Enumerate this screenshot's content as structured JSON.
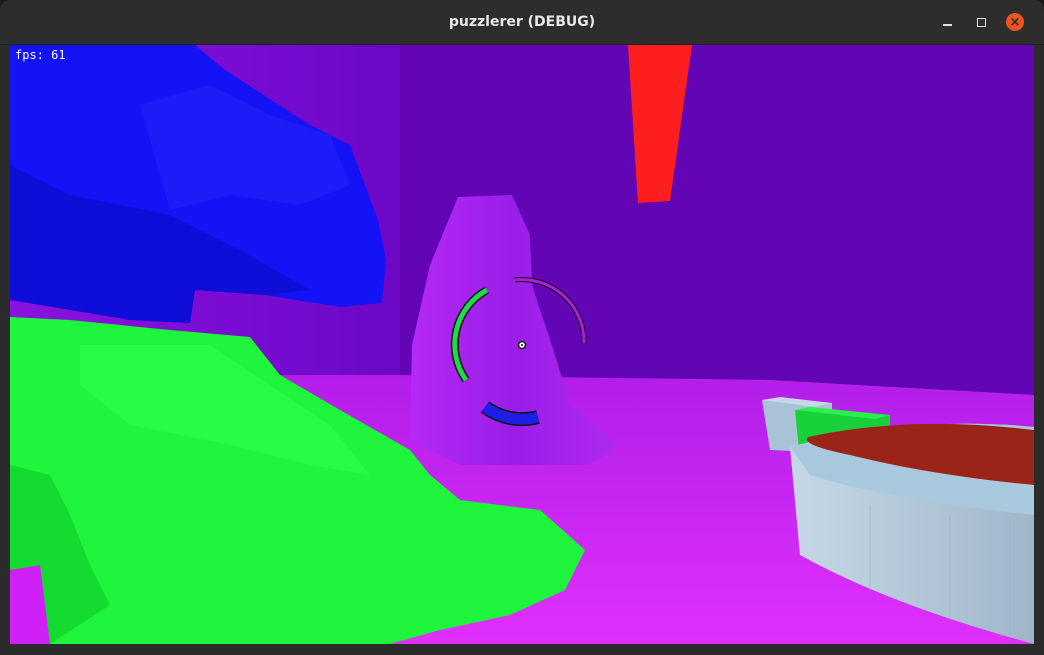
{
  "window": {
    "title": "puzzlerer (DEBUG)",
    "controls": {
      "minimize_icon": "minimize-icon",
      "maximize_icon": "maximize-icon",
      "close_icon": "close-icon",
      "close_glyph": "×",
      "close_color": "#e95420"
    }
  },
  "hud": {
    "fps_text": "fps: 61"
  },
  "scene": {
    "colors": {
      "back_wall": "#6206b5",
      "floor": "#c81ef0",
      "left_wall": "#7b0cd4",
      "blue_blob": "#1313f5",
      "green_blob": "#1ef53c",
      "magenta_pillar": "#a81ef0",
      "red_spike": "#ff1e1e",
      "platform_side": "#aabfd2",
      "platform_top": "#9b2418",
      "crosshair_green": "#22d94a",
      "crosshair_magenta": "#b21ed6",
      "crosshair_blue": "#1e1ee6"
    }
  }
}
